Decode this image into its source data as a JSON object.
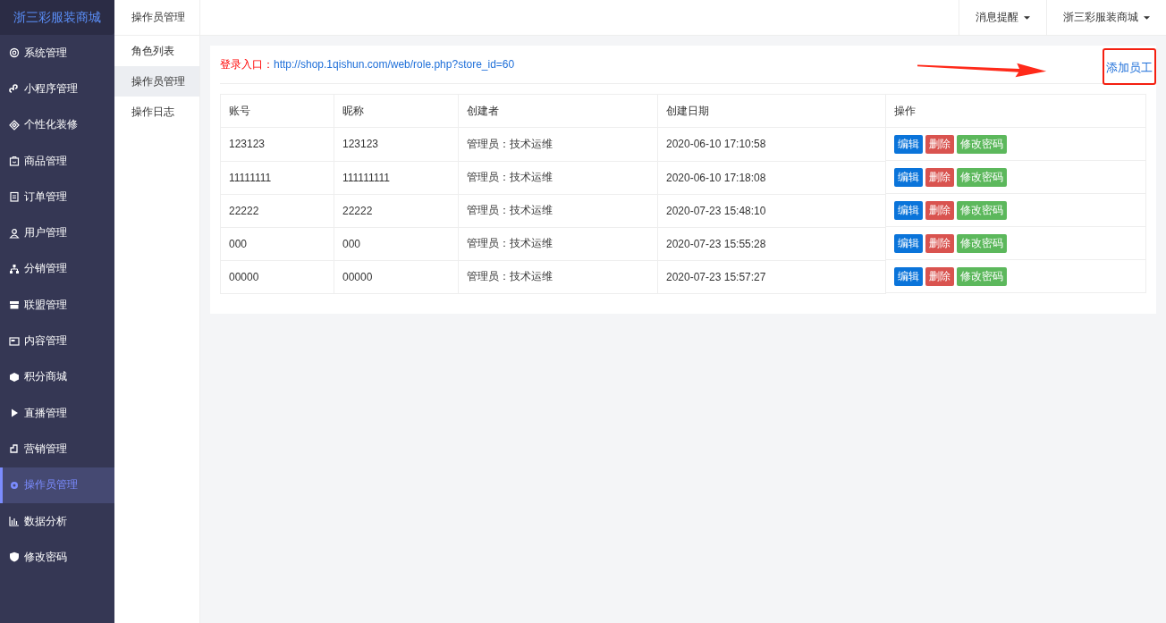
{
  "sidebar": {
    "logo": "浙三彩服装商城",
    "items": [
      {
        "label": "系统管理",
        "selected": false
      },
      {
        "label": "小程序管理",
        "selected": false
      },
      {
        "label": "个性化装修",
        "selected": false
      },
      {
        "label": "商品管理",
        "selected": false
      },
      {
        "label": "订单管理",
        "selected": false
      },
      {
        "label": "用户管理",
        "selected": false
      },
      {
        "label": "分销管理",
        "selected": false
      },
      {
        "label": "联盟管理",
        "selected": false
      },
      {
        "label": "内容管理",
        "selected": false
      },
      {
        "label": "积分商城",
        "selected": false
      },
      {
        "label": "直播管理",
        "selected": false
      },
      {
        "label": "营销管理",
        "selected": false
      },
      {
        "label": "操作员管理",
        "selected": true
      },
      {
        "label": "数据分析",
        "selected": false
      },
      {
        "label": "修改密码",
        "selected": false
      }
    ]
  },
  "submenu": {
    "title": "操作员管理",
    "items": [
      {
        "label": "角色列表",
        "selected": false
      },
      {
        "label": "操作员管理",
        "selected": true
      },
      {
        "label": "操作日志",
        "selected": false
      }
    ]
  },
  "topbar": {
    "menus": [
      "消息提醒",
      "浙三彩服装商城"
    ]
  },
  "login": {
    "label": "登录入口：",
    "url": "http://shop.1qishun.com/web/role.php?store_id=60"
  },
  "add_link": "添加员工",
  "table": {
    "columns": [
      "账号",
      "昵称",
      "创建者",
      "创建日期",
      "操作"
    ],
    "rows": [
      {
        "account": "123123",
        "nickname": "123123",
        "creator": "管理员：技术运维",
        "date": "2020-06-10 17:10:58",
        "actions": [
          {
            "kind": "edit",
            "label": "编辑"
          },
          {
            "kind": "delete",
            "label": "删除"
          },
          {
            "kind": "password",
            "label": "修改密码"
          }
        ]
      },
      {
        "account": "11111111",
        "nickname": "111111111",
        "creator": "管理员：技术运维",
        "date": "2020-06-10 17:18:08",
        "actions": [
          {
            "kind": "edit",
            "label": "编辑"
          },
          {
            "kind": "delete",
            "label": "删除"
          },
          {
            "kind": "password",
            "label": "修改密码"
          }
        ]
      },
      {
        "account": "22222",
        "nickname": "22222",
        "creator": "管理员：技术运维",
        "date": "2020-07-23 15:48:10",
        "actions": [
          {
            "kind": "edit",
            "label": "编辑"
          },
          {
            "kind": "delete",
            "label": "删除"
          },
          {
            "kind": "password",
            "label": "修改密码"
          }
        ]
      },
      {
        "account": "000",
        "nickname": "000",
        "creator": "管理员：技术运维",
        "date": "2020-07-23 15:55:28",
        "actions": [
          {
            "kind": "edit",
            "label": "编辑"
          },
          {
            "kind": "delete",
            "label": "删除"
          },
          {
            "kind": "password",
            "label": "修改密码"
          }
        ]
      },
      {
        "account": "00000",
        "nickname": "00000",
        "creator": "管理员：技术运维",
        "date": "2020-07-23 15:57:27",
        "actions": [
          {
            "kind": "edit",
            "label": "编辑"
          },
          {
            "kind": "delete",
            "label": "删除"
          },
          {
            "kind": "password",
            "label": "修改密码"
          }
        ]
      }
    ]
  }
}
